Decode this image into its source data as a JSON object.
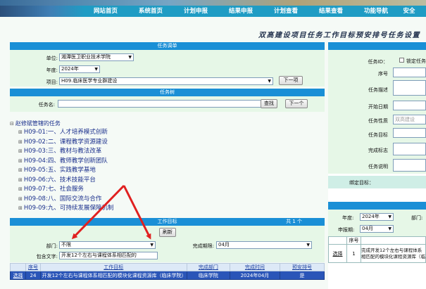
{
  "nav": {
    "items": [
      "网站首页",
      "系统首页",
      "计划申报",
      "结果申报",
      "计划查看",
      "结果查看",
      "功能导航",
      "安全"
    ]
  },
  "page_title": "双高建设项目任务工作目标预安排号任务设置",
  "task_list": {
    "header": "任务调单",
    "unit_label": "单位:",
    "unit_value": "湘潭医卫职业技术学院",
    "year_label": "年度:",
    "year_value": "2024年",
    "project_label": "项目:",
    "project_value": "H09.临床医学专业群建设",
    "next_button": "下一项"
  },
  "task_tree": {
    "header": "任务树",
    "name_label": "任务名:",
    "name_value": "",
    "search_button": "查找",
    "next_button": "下一个",
    "root": "赵修斌管辖的任务",
    "items": [
      "H09-01:一、人才培养模式创新",
      "H09-02:二、课程教学资源建设",
      "H09-03:三、教材与教法改革",
      "H09-04:四、教师教学创新团队",
      "H09-05:五、实践教学基地",
      "H09-06:六、技术技能平台",
      "H09-07:七、社会服务",
      "H09-08:八、国际交流与合作",
      "H09-09:九、可持续发展保障机制"
    ]
  },
  "work_goals": {
    "header": "工作目标",
    "count": "共 1 个",
    "refresh_button": "刷新",
    "dept_label": "部门:",
    "dept_value": "不限",
    "deadline_label": "完成期限:",
    "deadline_value": "04月",
    "contains_label": "包含文字:",
    "contains_value": "开发12个左右与课程体系相匹配的",
    "columns": [
      "",
      "序号",
      "工作目标",
      "完成部门",
      "完成时间",
      "预安排号"
    ],
    "rows": [
      [
        "选择",
        "24",
        "开发12个左右与课程体系相匹配的模块化课程资源库（临床学院）",
        "临床学院",
        "2024年04月",
        "是"
      ]
    ]
  },
  "right_panel": {
    "task_id_label": "任务ID：",
    "lock_label": "锁定任务",
    "seq_label": "序号",
    "desc_label": "任务描述",
    "start_label": "开始日期",
    "nature_label": "任务性质",
    "nature_value": "双高建设",
    "goal_label": "任务目标",
    "done_label": "完成标志",
    "note_label": "任务说明",
    "bind_label": "绑定目标：",
    "year_label": "年度:",
    "year_value": "2024年",
    "dept_label": "部门:",
    "period_label": "申报期:",
    "period_value": "04月",
    "grid_header": "序号",
    "grid_row_select": "选择",
    "grid_row_num": "1",
    "grid_row_text": "完成开发12个左右与课程体系相匹配的模块化课程资源库（临床学院）"
  },
  "colors": {
    "nav_bg": "#1f9cc4",
    "header_blue": "#1a8fd6",
    "panel_green": "#e6f7e7",
    "selected_row": "#2a55b8",
    "arrow_red": "#e02020"
  }
}
